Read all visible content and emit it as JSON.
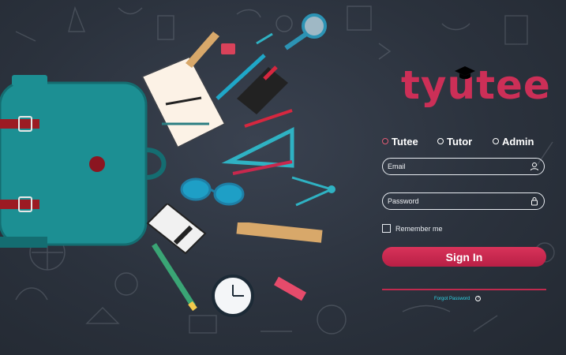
{
  "brand": {
    "logo_text": "tyutee",
    "logo_color": "#cc2f57"
  },
  "roles": [
    {
      "label": "Tutee",
      "selected": true
    },
    {
      "label": "Tutor",
      "selected": false
    },
    {
      "label": "Admin",
      "selected": false
    }
  ],
  "form": {
    "email_placeholder": "Email",
    "password_placeholder": "Password",
    "remember_label": "Remember me",
    "sign_in_label": "Sign In",
    "forgot_label": "Forgot Password",
    "forgot_icon": "?"
  },
  "colors": {
    "accent": "#c7294f",
    "link": "#2fd3e6",
    "background": "#2b323d"
  },
  "illustration": {
    "icons": [
      "backpack-icon",
      "notebook-icon",
      "pencil-icon",
      "ruler-icon",
      "magnifier-icon",
      "glasses-icon",
      "calculator-icon",
      "clock-icon",
      "compass-icon",
      "triangle-icon",
      "eraser-icon",
      "sharpener-icon"
    ]
  }
}
